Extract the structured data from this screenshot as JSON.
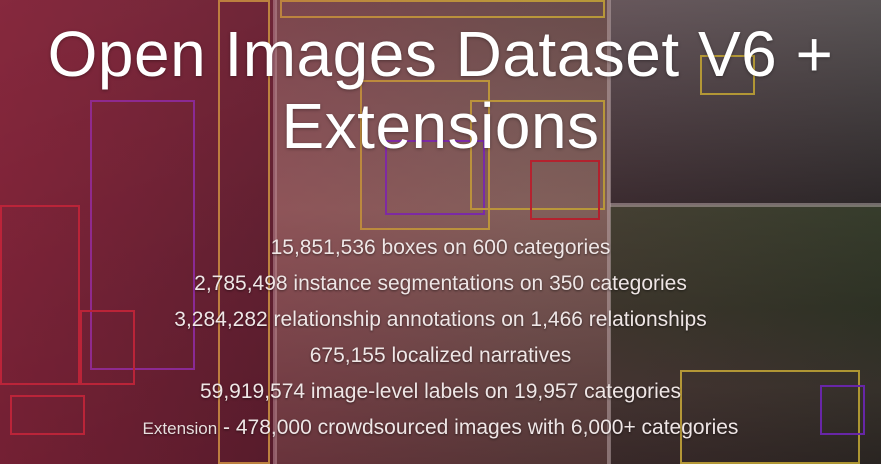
{
  "header": {
    "title_line1": "Open Images Dataset V6 +",
    "title_line2": "Extensions"
  },
  "stats": [
    {
      "text": "15,851,536 boxes on 600 categories"
    },
    {
      "text": "2,785,498 instance segmentations on 350 categories"
    },
    {
      "text": "3,284,282 relationship annotations on 1,466 relationships"
    },
    {
      "text": "675,155 localized narratives"
    },
    {
      "text": "59,919,574 image-level labels on 19,957 categories"
    }
  ],
  "extension": {
    "label": "Extension",
    "text": " - 478,000 crowdsourced images with 6,000+ categories"
  },
  "colors": {
    "overlay_accent": "#aa2846",
    "text": "#ffffff",
    "bbox_purple": "#7a2bd6",
    "bbox_yellow": "#d8c23a",
    "bbox_red": "#d0202a"
  }
}
